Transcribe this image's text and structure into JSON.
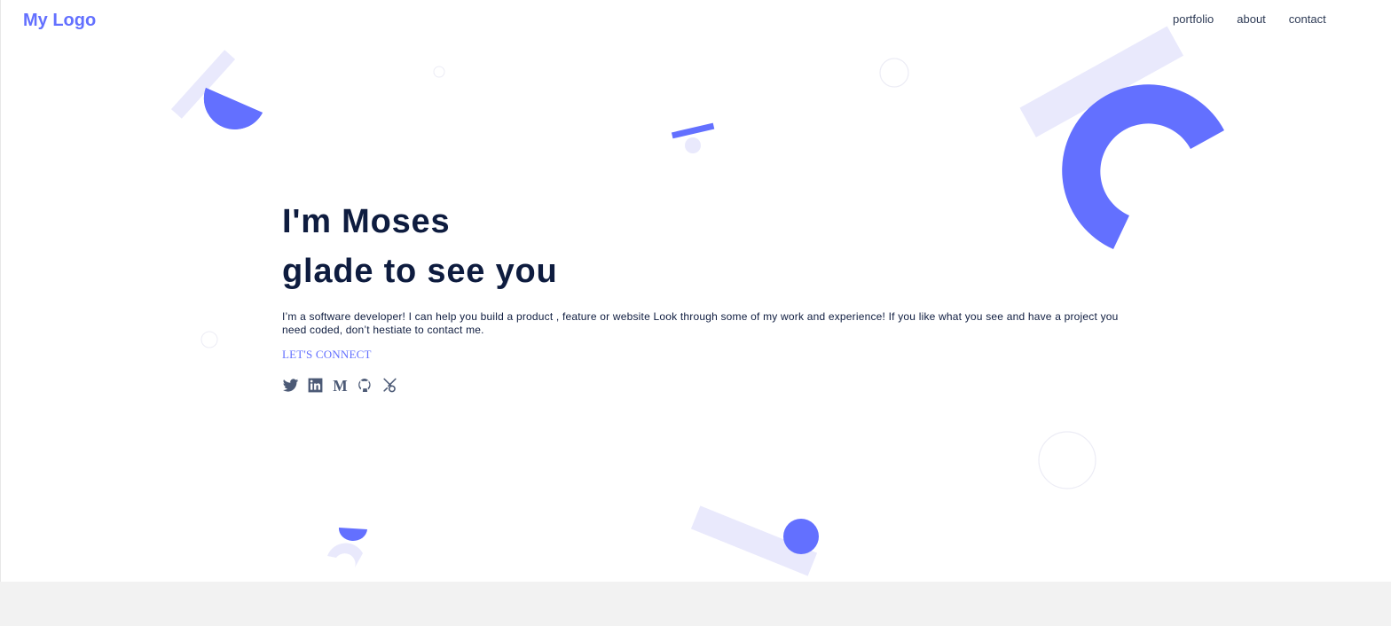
{
  "header": {
    "logo": "My Logo",
    "nav": [
      {
        "label": "portfolio"
      },
      {
        "label": "about"
      },
      {
        "label": "contact"
      }
    ]
  },
  "hero": {
    "title_line1": "I'm Moses",
    "title_line2": "glade to see you",
    "description": "I’m a software developer! I can help you build a product , feature or website Look through some of my work and experience! If you like what you see and have a project you need coded, don’t hestiate to contact me.",
    "cta": "LET'S CONNECT"
  },
  "socials": [
    {
      "icon": "twitter-icon"
    },
    {
      "icon": "linkedin-icon"
    },
    {
      "icon": "medium-icon"
    },
    {
      "icon": "github-icon"
    },
    {
      "icon": "codepen-icon"
    }
  ],
  "colors": {
    "accent": "#6370ff",
    "accent_light": "#e9e9fc",
    "text_dark": "#0e1c3f",
    "icon": "#4c5a76",
    "background_footer": "#f2f2f2"
  }
}
